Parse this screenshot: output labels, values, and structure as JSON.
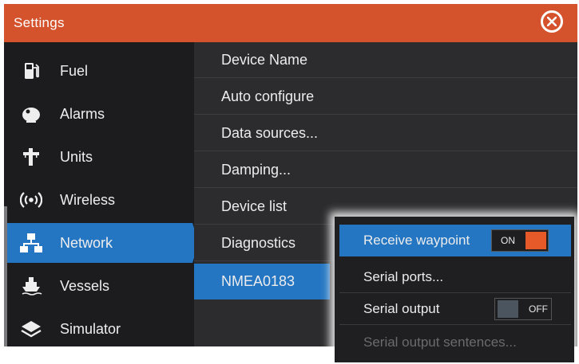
{
  "window": {
    "title": "Settings"
  },
  "sidebar": {
    "items": [
      {
        "label": "Fuel",
        "icon": "fuel-pump-icon"
      },
      {
        "label": "Alarms",
        "icon": "alarm-bell-icon"
      },
      {
        "label": "Units",
        "icon": "ruler-units-icon"
      },
      {
        "label": "Wireless",
        "icon": "wireless-icon"
      },
      {
        "label": "Network",
        "icon": "network-icon",
        "selected": true
      },
      {
        "label": "Vessels",
        "icon": "vessels-icon"
      },
      {
        "label": "Simulator",
        "icon": "simulator-layers-icon"
      }
    ]
  },
  "main": {
    "items": [
      {
        "label": "Device Name"
      },
      {
        "label": "Auto configure"
      },
      {
        "label": "Data sources..."
      },
      {
        "label": "Damping..."
      },
      {
        "label": "Device list"
      },
      {
        "label": "Diagnostics"
      },
      {
        "label": "NMEA0183",
        "selected": true
      }
    ]
  },
  "popup": {
    "items": [
      {
        "label": "Receive waypoint",
        "toggle": "ON",
        "toggle_on": true
      },
      {
        "label": "Serial ports..."
      },
      {
        "label": "Serial output",
        "toggle": "OFF",
        "toggle_on": false
      },
      {
        "label": "Serial output sentences...",
        "disabled": true
      }
    ]
  },
  "colors": {
    "title_bar": "#d4532c",
    "selection": "#2476c3",
    "toggle_on": "#e65a2a",
    "toggle_off": "#4a5560"
  }
}
